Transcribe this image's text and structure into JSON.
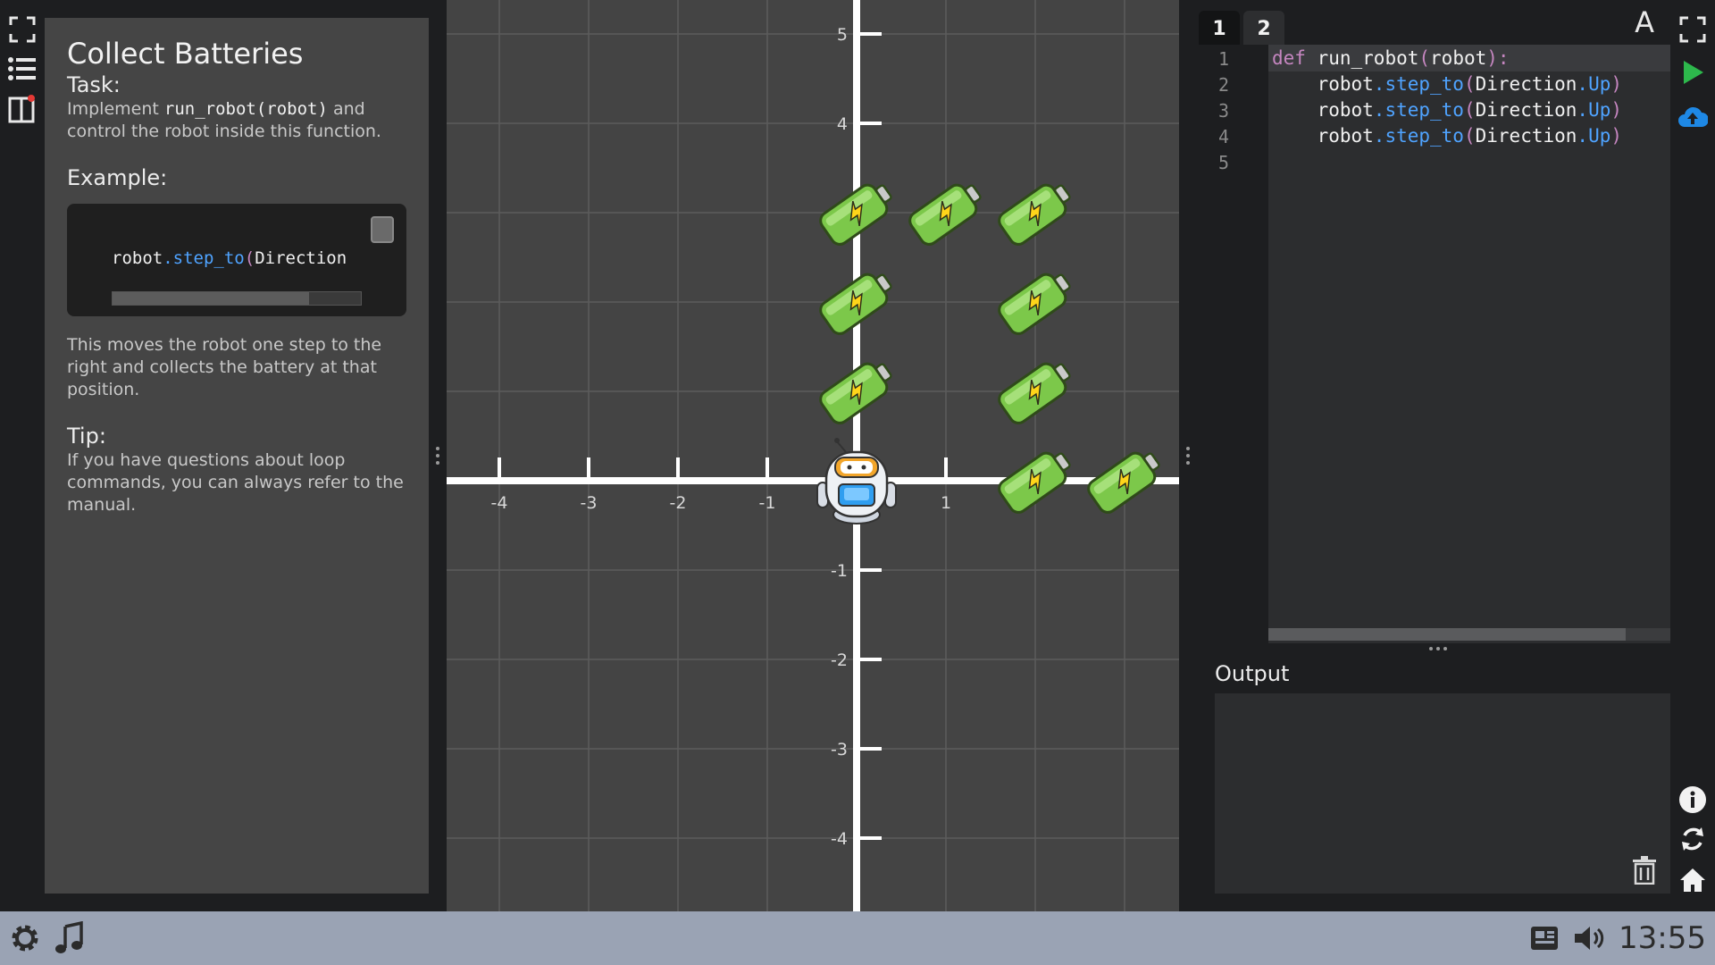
{
  "instructions": {
    "title": "Collect Batteries",
    "task_heading": "Task:",
    "task_prefix": "Implement ",
    "task_code": "run_robot(robot)",
    "task_suffix": " and control the robot inside this function.",
    "example_heading": "Example:",
    "example_code": {
      "obj": "robot",
      "dot": ".",
      "method": "step_to",
      "paren": "(",
      "arg": "Direction"
    },
    "example_desc": "This moves the robot one step to the right and collects the battery at that position.",
    "tip_heading": "Tip:",
    "tip_text": "If you have questions about loop commands, you can always refer to the manual."
  },
  "grid": {
    "x_ticks": [
      "-4",
      "-3",
      "-2",
      "-1",
      "1"
    ],
    "y_ticks": [
      "5",
      "4",
      "-1",
      "-2",
      "-3",
      "-4"
    ],
    "robot": {
      "x": 0,
      "y": 0
    },
    "batteries": [
      {
        "x": 0,
        "y": 3
      },
      {
        "x": 1,
        "y": 3
      },
      {
        "x": 2,
        "y": 3
      },
      {
        "x": 0,
        "y": 2
      },
      {
        "x": 2,
        "y": 2
      },
      {
        "x": 0,
        "y": 1
      },
      {
        "x": 2,
        "y": 1
      },
      {
        "x": 2,
        "y": 0
      },
      {
        "x": 3,
        "y": 0
      }
    ]
  },
  "editor": {
    "tabs": [
      "1",
      "2"
    ],
    "font_button": "A",
    "line_numbers": [
      "1",
      "2",
      "3",
      "4",
      "5"
    ],
    "code": {
      "l1_kw": "def",
      "l1_name": " run_robot",
      "l1_open": "(",
      "l1_arg": "robot",
      "l1_close": ")",
      "l1_colon": ":",
      "indent": "    ",
      "obj": "robot",
      "dot": ".",
      "method": "step_to",
      "open": "(",
      "arg": "Direction",
      "dot2": ".",
      "member": "Up",
      "close": ")"
    },
    "output_label": "Output"
  },
  "taskbar": {
    "clock": "13:55"
  },
  "colors": {
    "grid_bg": "#444444",
    "axis": "#ffffff",
    "run_green": "#2db84c",
    "cloud_blue": "#1e88e5"
  }
}
